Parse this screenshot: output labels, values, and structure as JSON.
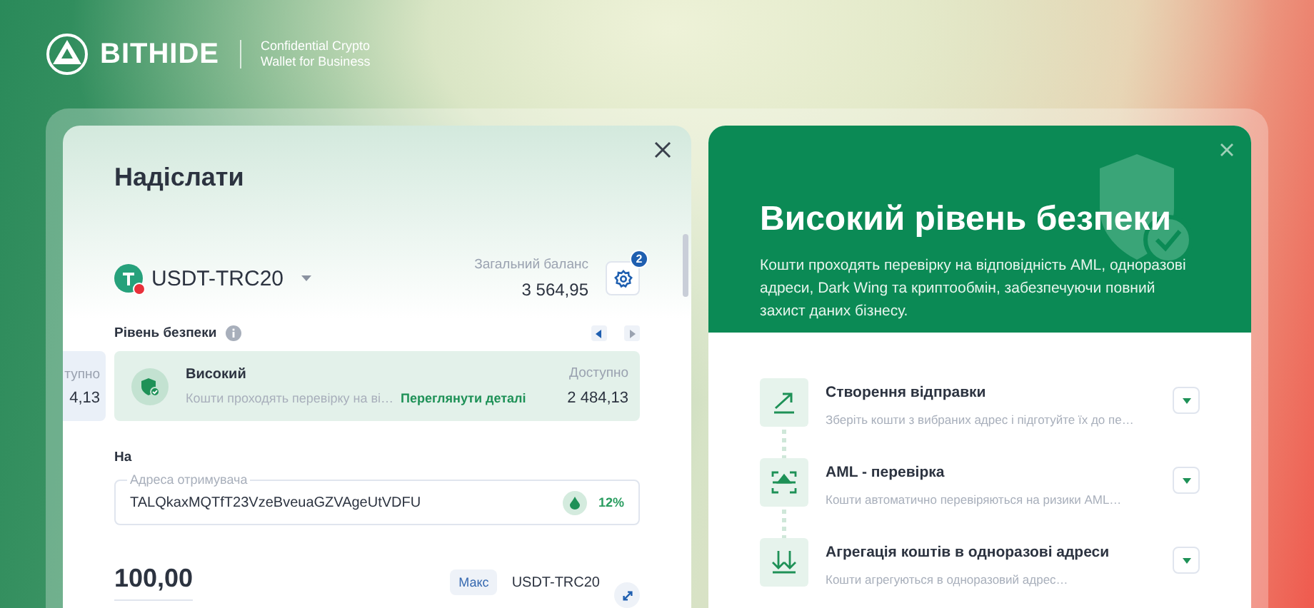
{
  "brand": {
    "name": "BITHIDE",
    "tagline": [
      "Confidential Crypto",
      "Wallet for Business"
    ]
  },
  "send": {
    "title": "Надіслати",
    "currency": "USDT-TRC20",
    "balance_label": "Загальний баланс",
    "balance": "3 564,95",
    "settings_badge": "2",
    "security_label": "Рівень безпеки",
    "levels": [
      {
        "kind": "partial",
        "available_label": "тупно",
        "available": "4,13",
        "selected": false
      },
      {
        "kind": "full",
        "name": "Високий",
        "description": "Кошти проходять перевірку на ві…",
        "link": "Переглянути деталі",
        "available_label": "Доступно",
        "available": "2 484,13",
        "selected": true
      }
    ],
    "to_label": "На",
    "address_label": "Адреса отримувача",
    "address": "TALQkaxMQTfT23VzeBveuaGZVAgeUtVDFU",
    "risk": "12%",
    "amount": "100,00",
    "max": "Макс",
    "amount_currency": "USDT-TRC20"
  },
  "details": {
    "title": "Високий рівень безпеки",
    "description": "Кошти проходять перевірку на відповідність AML, одноразові адреси, Dark Wing та криптообмін, забезпечуючи повний захист даних бізнесу.",
    "steps": [
      {
        "kind": "send",
        "title": "Створення відправки",
        "description": "Зберіть кошти з вибраних адрес і підготуйте їх до пе…",
        "expanded": false
      },
      {
        "kind": "aml",
        "title": "AML - перевірка",
        "description": "Кошти автоматично перевіряються на ризики AML…",
        "expanded": false
      },
      {
        "kind": "aggregate",
        "title": "Агрегація коштів в одноразові адреси",
        "description": "Кошти агрегуються в одноразовий адрес…",
        "expanded": false
      }
    ]
  }
}
